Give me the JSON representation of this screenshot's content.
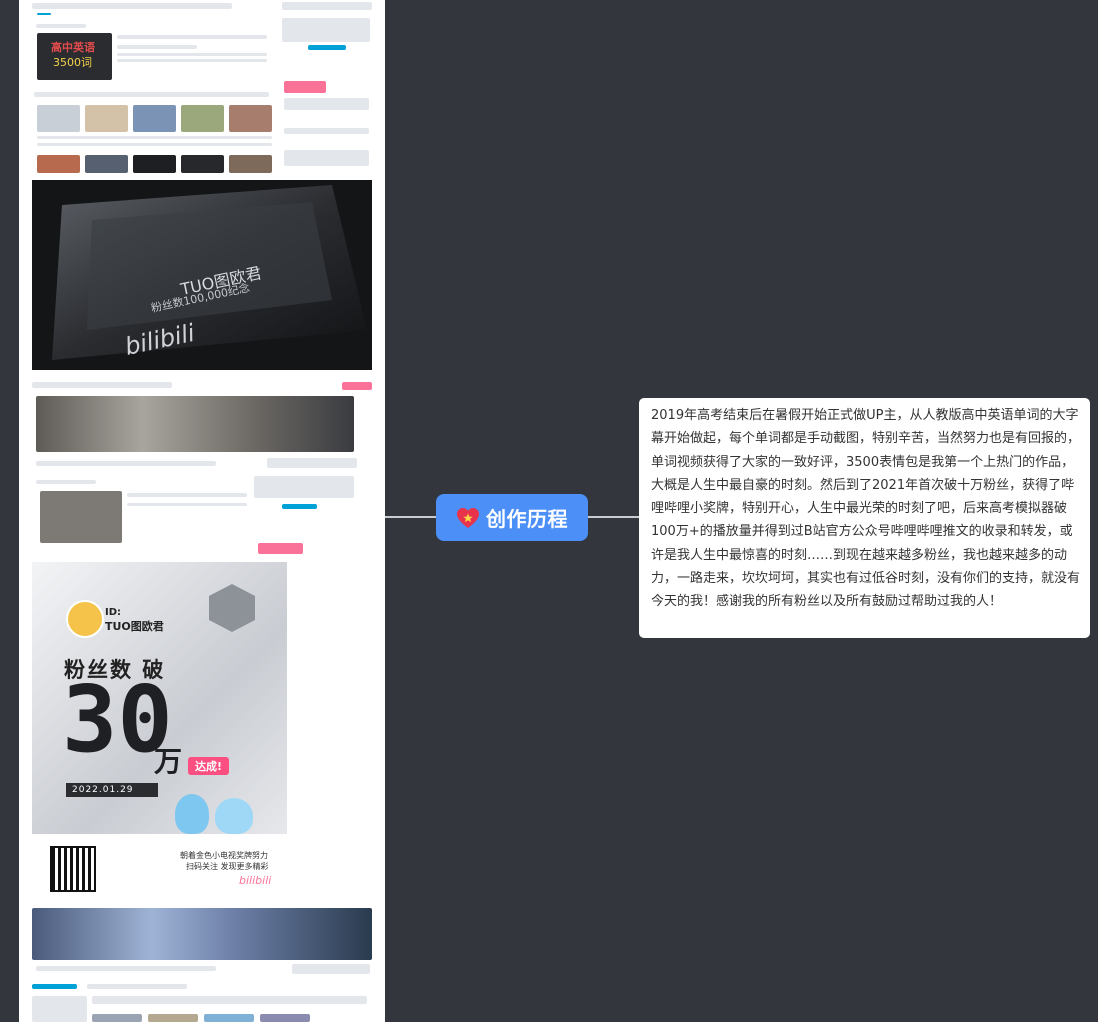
{
  "topic": {
    "title": "创作历程",
    "icon": "heart-star-icon",
    "color": "#4c8ff7"
  },
  "note": {
    "text": "2019年高考结束后在暑假开始正式做UP主，从人教版高中英语单词的大字幕开始做起，每个单词都是手动截图，特别辛苦，当然努力也是有回报的，单词视频获得了大家的一致好评，3500表情包是我第一个上热门的作品，大概是人生中最自豪的时刻。然后到了2021年首次破十万粉丝，获得了哔哩哔哩小奖牌，特别开心，人生中最光荣的时刻了吧，后来高考模拟器破100万+的播放量并得到过B站官方公众号哔哩哔哩推文的收录和转发，或许是我人生中最惊喜的时刻……到现在越来越多粉丝，我也越来越多的动力，一路走来，坎坎坷坷，其实也有过低谷时刻，没有你们的支持，就没有今天的我！感谢我的所有粉丝以及所有鼓励过帮助过我的人！"
  },
  "images": {
    "card1_title": "高中英语",
    "card1_sub": "3500词",
    "plaque_line1": "TUO图欧君",
    "plaque_line2": "粉丝数100,000纪念",
    "plaque_brand": "bilibili",
    "milestone_id_label": "ID:",
    "milestone_id": "TUO图欧君",
    "milestone_heading": "粉丝数 破",
    "milestone_number": "30",
    "milestone_unit": "万",
    "milestone_badge": "达成!",
    "milestone_date": "2022.01.29",
    "milestone_caption1": "朝着金色小电视奖牌努力",
    "milestone_caption2": "扫码关注 发现更多精彩",
    "milestone_brand": "bilibili"
  },
  "colors": {
    "background": "#33373d",
    "note_bg": "#ffffff",
    "bilibili_pink": "#fb7299",
    "bilibili_blue": "#00a1d6"
  }
}
